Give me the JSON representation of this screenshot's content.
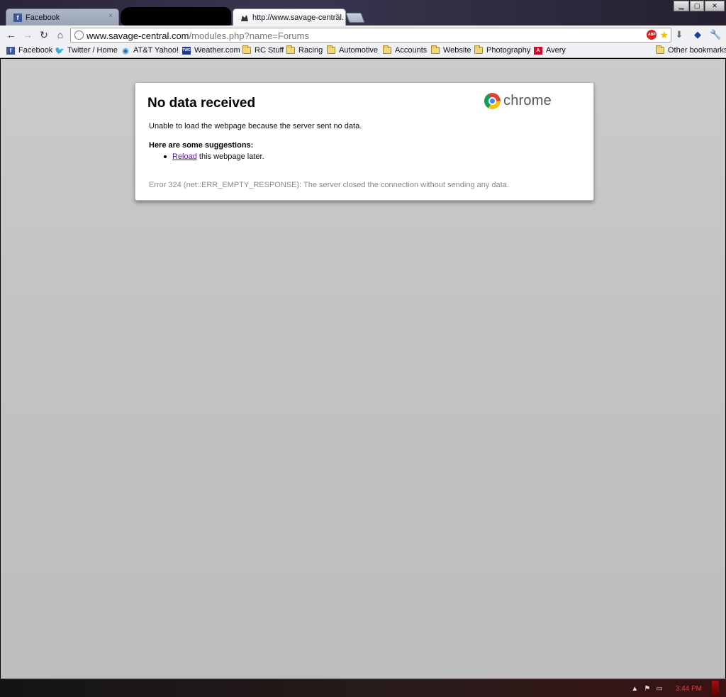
{
  "window": {
    "controls": {
      "minimize": "▁",
      "maximize": "▢",
      "close": "✕"
    }
  },
  "tabs": [
    {
      "title": "Facebook",
      "favicon": "facebook-icon",
      "close": "×",
      "active": false
    },
    {
      "title": "http://www.savage-central.",
      "favicon": "site-icon",
      "close": "×",
      "active": true
    }
  ],
  "toolbar": {
    "url_host": "www.savage-central.com",
    "url_path": "/modules.php?name=Forums"
  },
  "bookmarks": [
    {
      "label": "Facebook",
      "icon": "facebook-icon"
    },
    {
      "label": "Twitter / Home",
      "icon": "twitter-icon"
    },
    {
      "label": "AT&T Yahoo!",
      "icon": "att-icon"
    },
    {
      "label": "Weather.com",
      "icon": "weather-icon"
    },
    {
      "label": "RC Stuff",
      "icon": "folder-icon"
    },
    {
      "label": "Racing",
      "icon": "folder-icon"
    },
    {
      "label": "Automotive",
      "icon": "folder-icon"
    },
    {
      "label": "Accounts",
      "icon": "folder-icon"
    },
    {
      "label": "Website",
      "icon": "folder-icon"
    },
    {
      "label": "Photography",
      "icon": "folder-icon"
    },
    {
      "label": "Avery",
      "icon": "avery-icon"
    }
  ],
  "other_bookmarks": "Other bookmarks",
  "error_page": {
    "title": "No data received",
    "brand": "chrome",
    "message": "Unable to load the webpage because the server sent no data.",
    "suggestions_heading": "Here are some suggestions:",
    "suggestion_link": "Reload",
    "suggestion_rest": " this webpage later.",
    "error_detail": "Error 324 (net::ERR_EMPTY_RESPONSE): The server closed the connection without sending any data."
  },
  "taskbar": {
    "clock": "3:44 PM"
  },
  "colors": {
    "link_visited": "#551a8b",
    "content_bg": "#c6c6c6",
    "clock": "#e04040"
  }
}
